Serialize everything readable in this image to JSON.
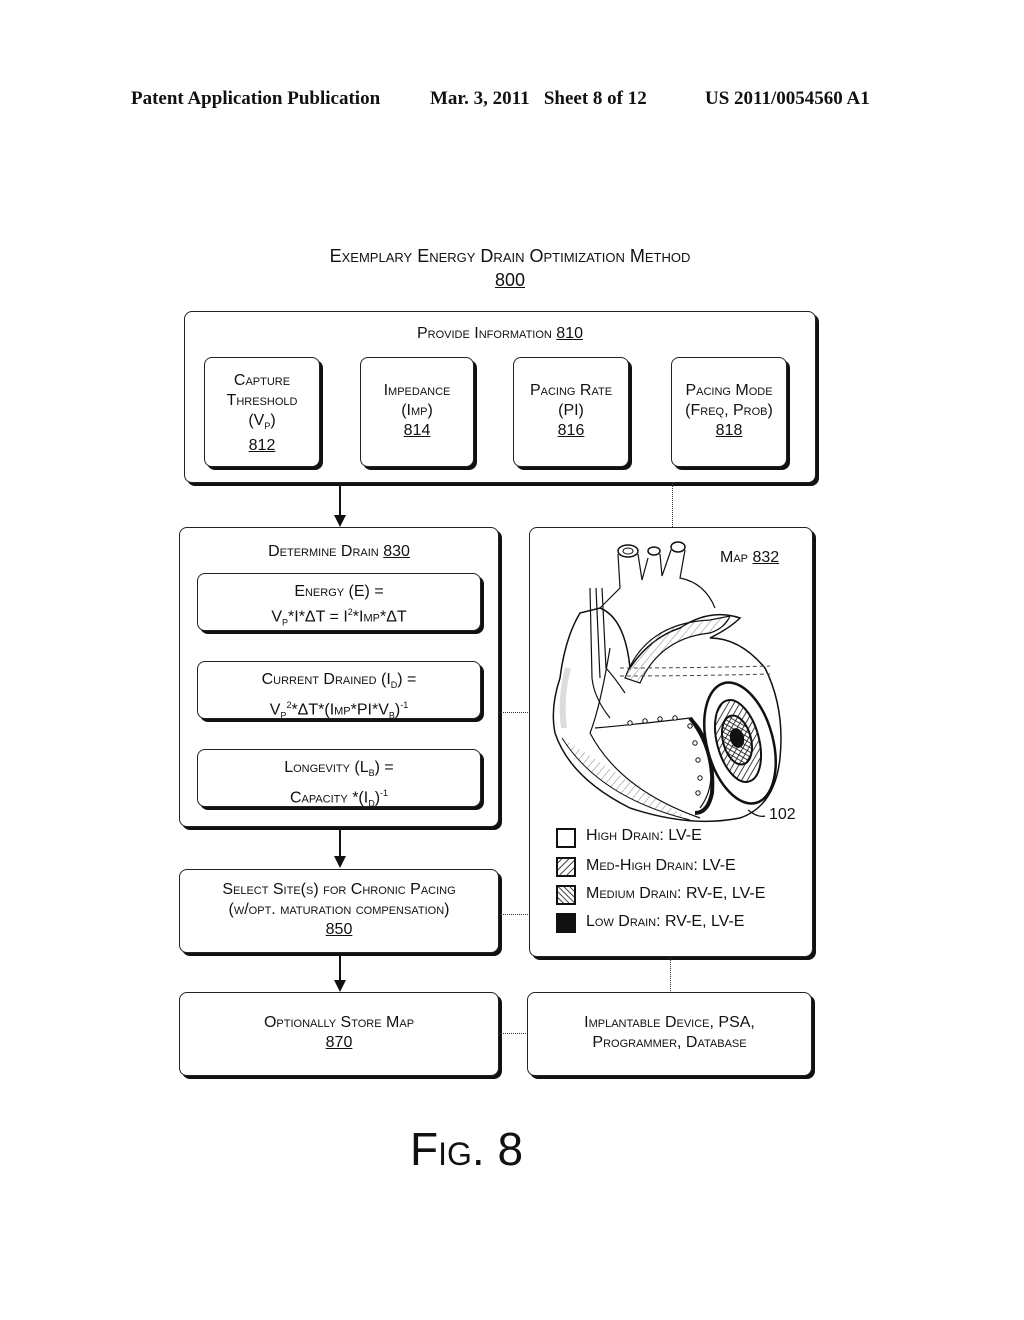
{
  "header": {
    "publication": "Patent Application Publication",
    "date_sheet": "Mar. 3, 2011   Sheet 8 of 12",
    "number": "US 2011/0054560 A1"
  },
  "figure": {
    "title": "Exemplary Energy Drain Optimization Method",
    "ref": "800",
    "caption": "Fig. 8"
  },
  "provide": {
    "label": "Provide Information ",
    "ref": "810",
    "items": [
      {
        "line1": "Capture",
        "line2": "Threshold",
        "line3a": "(V",
        "line3sub": "P",
        "line3b": ")",
        "ref": "812"
      },
      {
        "line1": "Impedance",
        "line2": "(Imp)",
        "ref": "814"
      },
      {
        "line1": "Pacing Rate",
        "line2": "(PI)",
        "ref": "816"
      },
      {
        "line1": "Pacing Mode",
        "line2": "(Freq, Prob)",
        "ref": "818"
      }
    ]
  },
  "determine": {
    "label": "Determine Drain ",
    "ref": "830",
    "energy": {
      "l1": "Energy (E) =",
      "a": "V",
      "asub": "P",
      "b": "*I*ΔT = I",
      "bsup": "2",
      "c": "*Imp*ΔT"
    },
    "current": {
      "l1a": "Current Drained (I",
      "l1sub": "D",
      "l1b": ") =",
      "a": "V",
      "asub": "P",
      "asup": "2",
      "b": "*ΔT*(Imp*PI*V",
      "bsub": "B",
      "c": ")",
      "csup": "-1"
    },
    "longevity": {
      "l1a": "Longevity (L",
      "l1sub": "B",
      "l1b": ") =",
      "a": "Capacity *(I",
      "asub": "D",
      "b": ")",
      "bsup": "-1"
    }
  },
  "map": {
    "label": "Map ",
    "ref": "832",
    "device_ref": "102",
    "legend": [
      {
        "label": "High Drain: LV-E",
        "fill": "none"
      },
      {
        "label": "Med-High Drain: LV-E",
        "fill": "hatch-right"
      },
      {
        "label": "Medium Drain: RV-E, LV-E",
        "fill": "hatch-left"
      },
      {
        "label": "Low Drain: RV-E, LV-E",
        "fill": "solid"
      }
    ]
  },
  "select": {
    "l1": "Select Site(s) for Chronic Pacing",
    "l2": "(w/opt. maturation compensation)",
    "ref": "850"
  },
  "store": {
    "l1": "Optionally Store Map",
    "ref": "870"
  },
  "devices": {
    "l1": "Implantable Device, PSA,",
    "l2": "Programmer, Database"
  }
}
